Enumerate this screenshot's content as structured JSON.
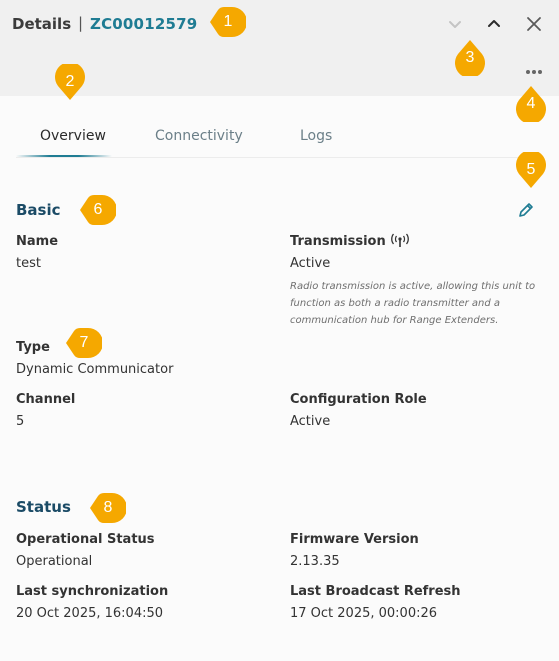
{
  "header": {
    "title": "Details",
    "separator": "|",
    "device_id": "ZC00012579"
  },
  "tabs": [
    {
      "label": "Overview",
      "active": true
    },
    {
      "label": "Connectivity",
      "active": false
    },
    {
      "label": "Logs",
      "active": false
    }
  ],
  "basic": {
    "title": "Basic",
    "name_label": "Name",
    "name_value": "test",
    "transmission_label": "Transmission",
    "transmission_value": "Active",
    "transmission_note": "Radio transmission is active, allowing this unit to function as both a radio transmitter and a communication hub for Range Extenders.",
    "type_label": "Type",
    "type_value": "Dynamic Communicator",
    "channel_label": "Channel",
    "channel_value": "5",
    "config_role_label": "Configuration Role",
    "config_role_value": "Active"
  },
  "status": {
    "title": "Status",
    "operational_label": "Operational Status",
    "operational_value": "Operational",
    "firmware_label": "Firmware Version",
    "firmware_value": "2.13.35",
    "last_sync_label": "Last synchronization",
    "last_sync_value": "20 Oct 2025, 16:04:50",
    "last_broadcast_label": "Last Broadcast Refresh",
    "last_broadcast_value": "17 Oct 2025, 00:00:26"
  },
  "markers": [
    "1",
    "2",
    "3",
    "4",
    "5",
    "6",
    "7",
    "8"
  ],
  "colors": {
    "accent": "#1f7c93",
    "section_title": "#1b4b66",
    "marker": "#f5a800"
  }
}
